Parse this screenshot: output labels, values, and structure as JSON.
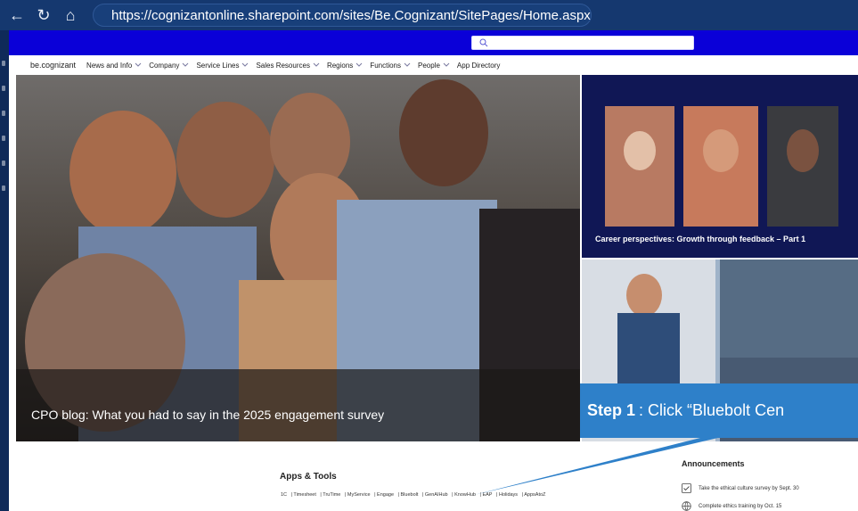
{
  "browser": {
    "url": "https://cognizantonline.sharepoint.com/sites/Be.Cognizant/SitePages/Home.aspx"
  },
  "nav": {
    "brand": "be.cognizant",
    "items": [
      "News and Info",
      "Company",
      "Service Lines",
      "Sales Resources",
      "Regions",
      "Functions",
      "People",
      "App Directory"
    ]
  },
  "hero": {
    "caption": "CPO blog: What you had to say in the 2025 engagement survey"
  },
  "tiles": {
    "tile1_caption": "Career perspectives: Growth through feedback – Part 1"
  },
  "callout": {
    "step": "Step 1",
    "text": ": Click “Bluebolt Cen"
  },
  "apps_tools": {
    "title": "Apps & Tools",
    "links": [
      "1C",
      "Timesheet",
      "TruTime",
      "MyService",
      "Engage",
      "Bluebolt",
      "GenAIHub",
      "KnowHub",
      "EAP",
      "Holidays",
      "AppsAtoZ"
    ]
  },
  "announcements": {
    "title": "Announcements",
    "items": [
      {
        "icon": "checkbox-icon",
        "text": "Take the ethical culture survey by Sept. 30"
      },
      {
        "icon": "globe-icon",
        "text": "Complete ethics training by Oct. 15"
      }
    ]
  },
  "colors": {
    "browser_bar": "#15386f",
    "suite_bar": "#0a00d8",
    "callout": "#2e80c9",
    "tile_dark": "#101755"
  }
}
